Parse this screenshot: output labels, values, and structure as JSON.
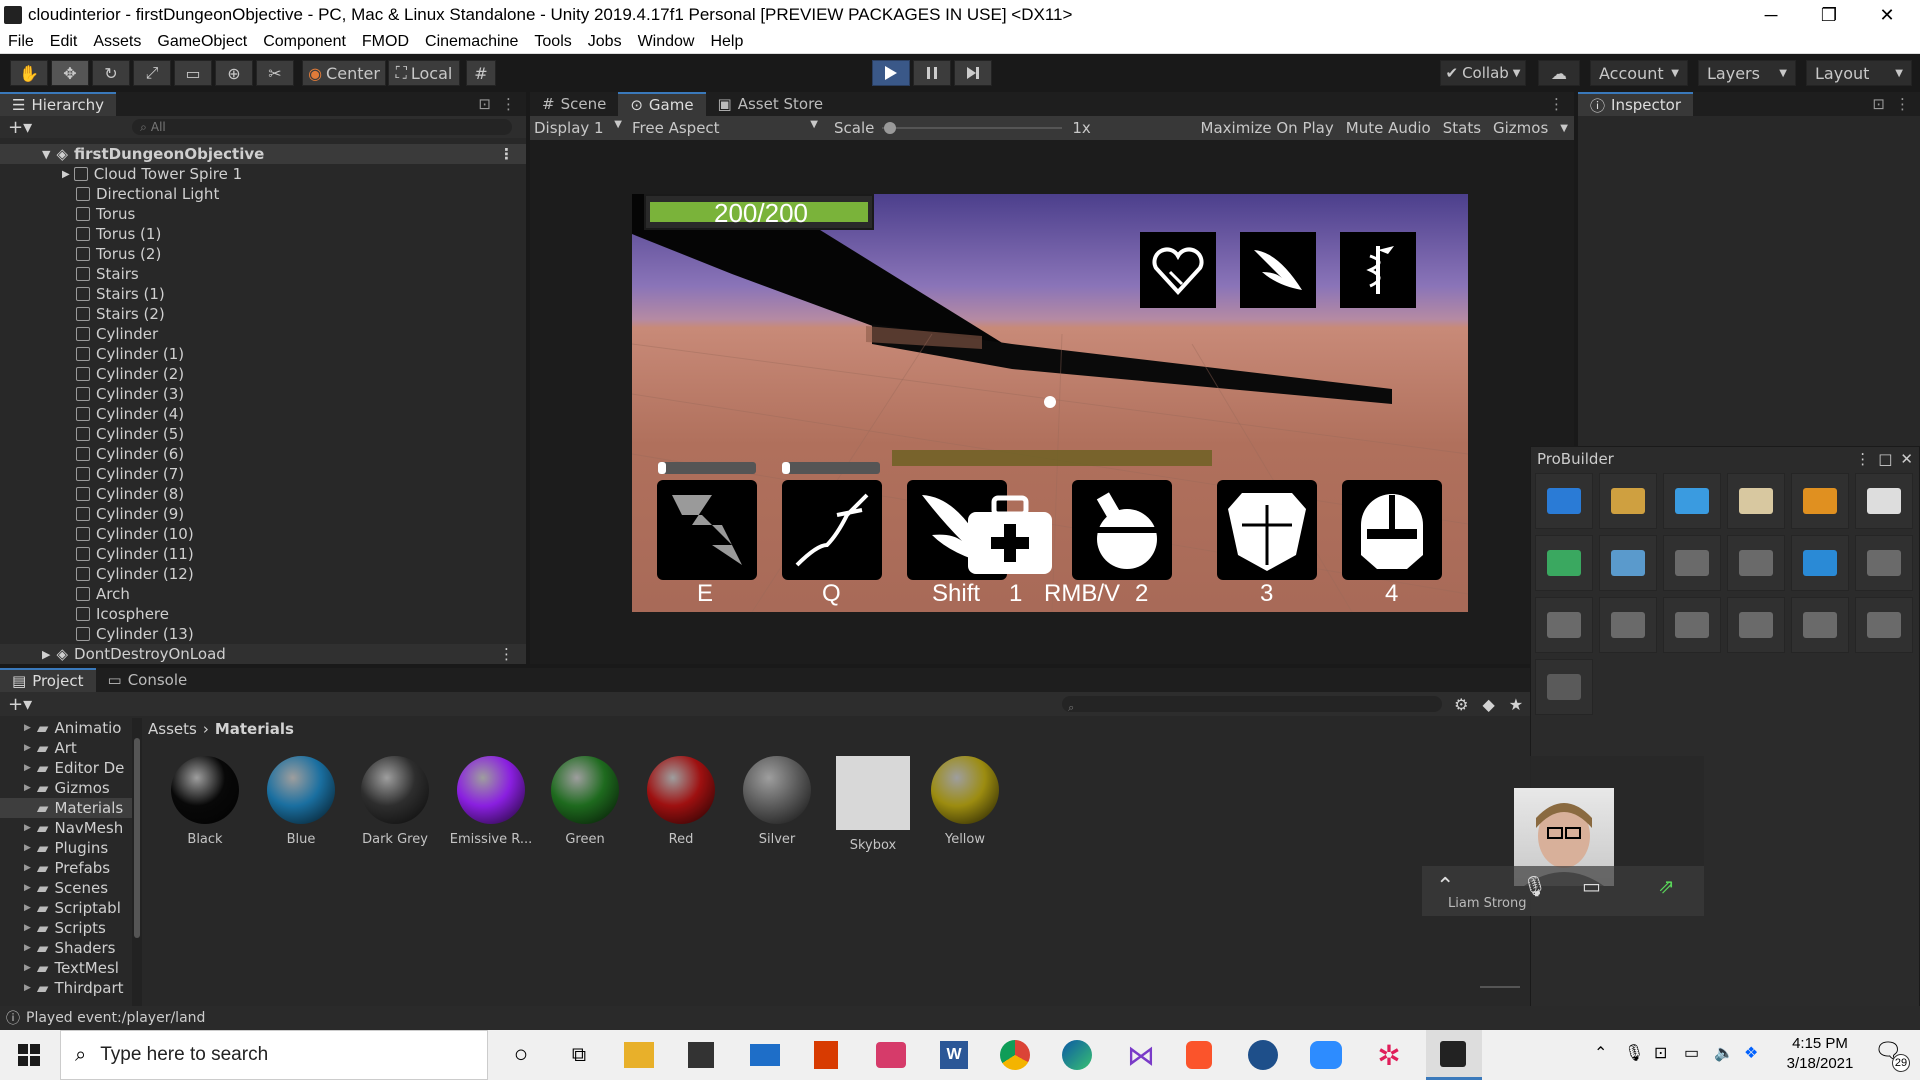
{
  "window": {
    "title": "cloudinterior - firstDungeonObjective - PC, Mac & Linux Standalone - Unity 2019.4.17f1 Personal [PREVIEW PACKAGES IN USE] <DX11>",
    "minimize": "─",
    "restore": "❐",
    "close": "✕"
  },
  "menu": [
    "File",
    "Edit",
    "Assets",
    "GameObject",
    "Component",
    "FMOD",
    "Cinemachine",
    "Tools",
    "Jobs",
    "Window",
    "Help"
  ],
  "toolbar": {
    "center": "Center",
    "local": "Local",
    "collab": "Collab",
    "account": "Account",
    "layers": "Layers",
    "layout": "Layout",
    "icons": [
      "hand-icon",
      "move-icon",
      "rotate-icon",
      "scale-icon",
      "rect-icon",
      "transform-icon",
      "custom-tool-icon"
    ]
  },
  "hierarchy": {
    "title": "Hierarchy",
    "search_placeholder": "All",
    "scene": "firstDungeonObjective",
    "items": [
      "Cloud Tower Spire 1",
      "Directional Light",
      "Torus",
      "Torus (1)",
      "Torus (2)",
      "Stairs",
      "Stairs (1)",
      "Stairs (2)",
      "Cylinder",
      "Cylinder (1)",
      "Cylinder (2)",
      "Cylinder (3)",
      "Cylinder (4)",
      "Cylinder (5)",
      "Cylinder (6)",
      "Cylinder (7)",
      "Cylinder (8)",
      "Cylinder (9)",
      "Cylinder (10)",
      "Cylinder (11)",
      "Cylinder (12)",
      "Arch",
      "Icosphere",
      "Cylinder (13)"
    ],
    "dontdestroy": "DontDestroyOnLoad"
  },
  "center_tabs": {
    "scene": "Scene",
    "game": "Game",
    "asset_store": "Asset Store"
  },
  "game_toolbar": {
    "display": "Display 1",
    "aspect": "Free Aspect",
    "scale_label": "Scale",
    "scale_value": "1x",
    "maximize": "Maximize On Play",
    "mute": "Mute Audio",
    "stats": "Stats",
    "gizmos": "Gizmos"
  },
  "game": {
    "health": "200/200",
    "health_fraction": 1.0,
    "skills": [
      {
        "key": "E",
        "icon": "lightning-arrow-icon"
      },
      {
        "key": "Q",
        "icon": "dash-icon"
      },
      {
        "key": "Shift",
        "icon": "wing-icon"
      },
      {
        "key": "1",
        "icon": "medkit-icon"
      },
      {
        "key": "RMB/V",
        "icon": "potion-icon"
      },
      {
        "key": "2",
        "icon": "potion-icon"
      },
      {
        "key": "3",
        "icon": "armor-icon"
      },
      {
        "key": "4",
        "icon": "helmet-icon"
      }
    ],
    "top_icons": [
      "heart-icon",
      "wing-icon",
      "caduceus-icon"
    ]
  },
  "inspector": {
    "title": "Inspector"
  },
  "probuilder": {
    "title": "ProBuilder"
  },
  "bottom_tabs": {
    "project": "Project",
    "console": "Console"
  },
  "project": {
    "folders": [
      "Animatio",
      "Art",
      "Editor De",
      "Gizmos",
      "Materials",
      "NavMesh",
      "Plugins",
      "Prefabs",
      "Scenes",
      "Scriptabl",
      "Scripts",
      "Shaders",
      "TextMesl",
      "Thirdpart"
    ],
    "breadcrumb": {
      "root": "Assets",
      "current": "Materials"
    },
    "materials": [
      {
        "name": "Black",
        "color": "#080808"
      },
      {
        "name": "Blue",
        "color": "#1a6fa0"
      },
      {
        "name": "Dark Grey",
        "color": "#2e2e2e"
      },
      {
        "name": "Emissive R...",
        "color": "#8a1fe0"
      },
      {
        "name": "Green",
        "color": "#1e6a1e"
      },
      {
        "name": "Red",
        "color": "#9e1010"
      },
      {
        "name": "Silver",
        "color": "#5c5c5c"
      },
      {
        "name": "Skybox",
        "color": "#d8d8d8"
      },
      {
        "name": "Yellow",
        "color": "#9c8c10"
      }
    ]
  },
  "video": {
    "name": "Liam Strong"
  },
  "status": {
    "message": "Played event:/player/land"
  },
  "taskbar": {
    "search": "Type here to search",
    "time": "4:15 PM",
    "date": "3/18/2021",
    "notifications": "29"
  }
}
